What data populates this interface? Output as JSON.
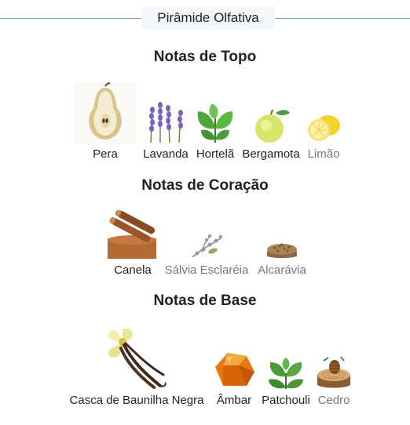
{
  "header": {
    "title": "Pirâmide Olfativa"
  },
  "sections": {
    "top": {
      "title": "Notas de Topo",
      "notes": [
        {
          "label": "Pera",
          "icon": "pear-icon"
        },
        {
          "label": "Lavanda",
          "icon": "lavender-icon"
        },
        {
          "label": "Hortelã",
          "icon": "mint-icon"
        },
        {
          "label": "Bergamota",
          "icon": "bergamot-icon"
        },
        {
          "label": "Limão",
          "icon": "lemon-icon"
        }
      ]
    },
    "heart": {
      "title": "Notas de Coração",
      "notes": [
        {
          "label": "Canela",
          "icon": "cinnamon-icon"
        },
        {
          "label": "Sálvia Esclaréia",
          "icon": "clary-sage-icon"
        },
        {
          "label": "Alcarávia",
          "icon": "caraway-icon"
        }
      ]
    },
    "base": {
      "title": "Notas de Base",
      "notes": [
        {
          "label": "Casca de Baunilha Negra",
          "icon": "vanilla-icon"
        },
        {
          "label": "Âmbar",
          "icon": "amber-icon"
        },
        {
          "label": "Patchouli",
          "icon": "patchouli-icon"
        },
        {
          "label": "Cedro",
          "icon": "cedar-icon"
        }
      ]
    }
  },
  "colors": {
    "divider": "#7aa6a1",
    "header_bg": "#f3f7fb",
    "text": "#222222",
    "muted_text": "#777777"
  }
}
